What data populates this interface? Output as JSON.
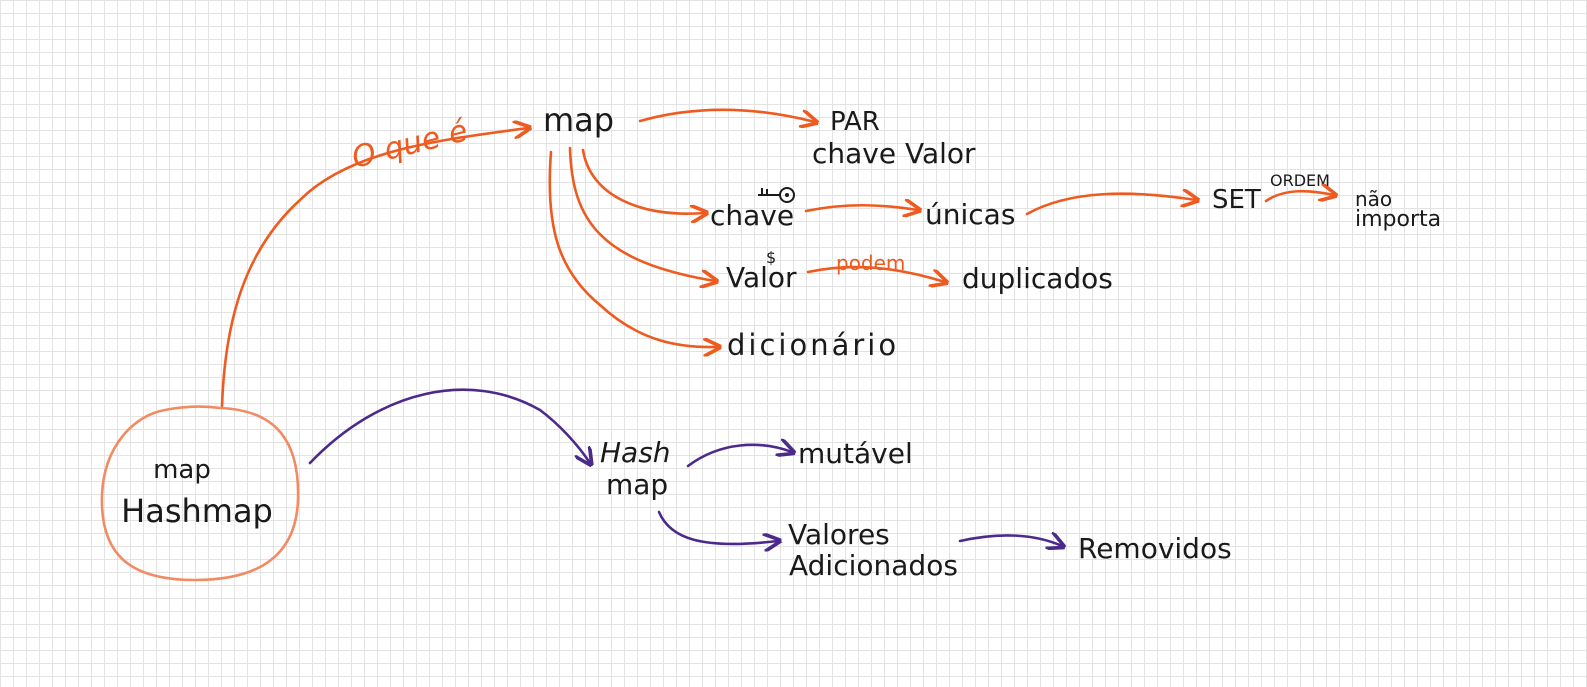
{
  "colors": {
    "orange": "#ef5a1f",
    "purple": "#4b2a8c",
    "ink": "#1a1a1a",
    "circle": "#f28a62",
    "grid": "#e3e3e3"
  },
  "root": {
    "line1": "map",
    "line2": "Hashmap"
  },
  "orange_branch": {
    "edge_label": "O que é",
    "map": "map",
    "par_line1": "PAR",
    "par_line2": "chave Valor",
    "chave": "chave",
    "unicas": "únicas",
    "set": "SET",
    "ordem": "ORDEM",
    "nao_importa_line1": "não",
    "nao_importa_line2": "importa",
    "valor": "Valor",
    "podem": "podem",
    "duplicados": "duplicados",
    "dicionario": "dicionário"
  },
  "purple_branch": {
    "hashmap_line1": "Hash",
    "hashmap_line2": "map",
    "mutavel": "mutável",
    "valores_line1": "Valores",
    "valores_line2": "Adicionados",
    "removidos": "Removidos"
  },
  "icons": [
    "key-icon",
    "dollar-icon"
  ]
}
